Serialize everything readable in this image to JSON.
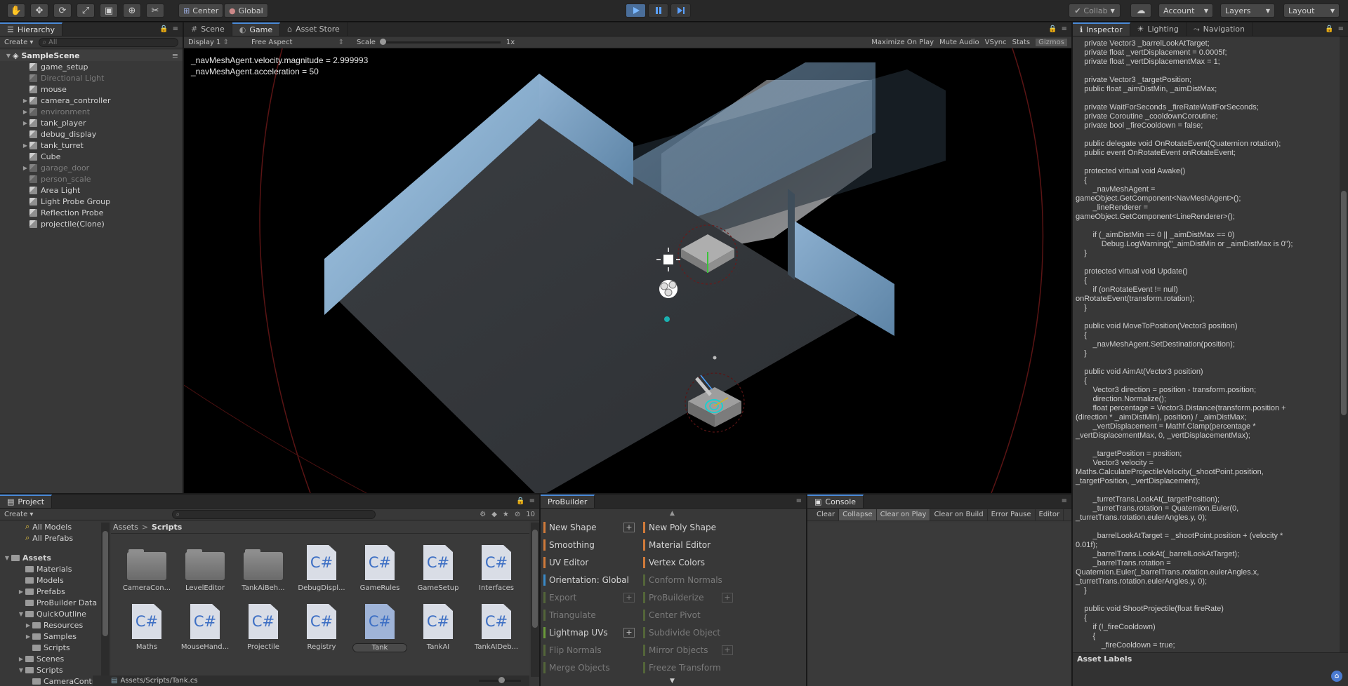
{
  "toolbar": {
    "tools": [
      "hand-tool",
      "move-tool",
      "rotate-tool",
      "scale-tool",
      "rect-tool",
      "transform-tool",
      "custom-tool"
    ],
    "pivot_label": "Center",
    "space_label": "Global",
    "collab_label": "Collab",
    "account_label": "Account",
    "layers_label": "Layers",
    "layout_label": "Layout",
    "play_color": "#4a6e9a"
  },
  "hierarchy": {
    "tab_label": "Hierarchy",
    "create_label": "Create",
    "search_placeholder": "All",
    "scene_name": "SampleScene",
    "items": [
      {
        "label": "game_setup",
        "dim": false,
        "expandable": false
      },
      {
        "label": "Directional Light",
        "dim": true,
        "expandable": false
      },
      {
        "label": "mouse",
        "dim": false,
        "expandable": false
      },
      {
        "label": "camera_controller",
        "dim": false,
        "expandable": true
      },
      {
        "label": "environment",
        "dim": true,
        "expandable": true
      },
      {
        "label": "tank_player",
        "dim": false,
        "expandable": true
      },
      {
        "label": "debug_display",
        "dim": false,
        "expandable": false
      },
      {
        "label": "tank_turret",
        "dim": false,
        "expandable": true
      },
      {
        "label": "Cube",
        "dim": false,
        "expandable": false
      },
      {
        "label": "garage_door",
        "dim": true,
        "expandable": true
      },
      {
        "label": "person_scale",
        "dim": true,
        "expandable": false
      },
      {
        "label": "Area Light",
        "dim": false,
        "expandable": false
      },
      {
        "label": "Light Probe Group",
        "dim": false,
        "expandable": false
      },
      {
        "label": "Reflection Probe",
        "dim": false,
        "expandable": false
      },
      {
        "label": "projectile(Clone)",
        "dim": false,
        "expandable": false
      }
    ]
  },
  "gameview": {
    "tabs": [
      {
        "label": "Scene",
        "active": false
      },
      {
        "label": "Game",
        "active": true
      },
      {
        "label": "Asset Store",
        "active": false
      }
    ],
    "display_label": "Display 1",
    "aspect_label": "Free Aspect",
    "scale_label": "Scale",
    "scale_value": "1x",
    "options": [
      "Maximize On Play",
      "Mute Audio",
      "VSync",
      "Stats",
      "Gizmos"
    ],
    "overlay_lines": [
      "_navMeshAgent.velocity.magnitude = 2.999993",
      "_navMeshAgent.acceleration = 50"
    ]
  },
  "inspector": {
    "tabs": [
      {
        "label": "Inspector",
        "active": true
      },
      {
        "label": "Lighting",
        "active": false
      },
      {
        "label": "Navigation",
        "active": false
      }
    ],
    "code_lines": [
      "    private Vector3 _barrelLookAtTarget;",
      "    private float _vertDisplacement = 0.0005f;",
      "    private float _vertDisplacementMax = 1;",
      "",
      "    private Vector3 _targetPosition;",
      "    public float _aimDistMin, _aimDistMax;",
      "",
      "    private WaitForSeconds _fireRateWaitForSeconds;",
      "    private Coroutine _cooldownCoroutine;",
      "    private bool _fireCooldown = false;",
      "",
      "    public delegate void OnRotateEvent(Quaternion rotation);",
      "    public event OnRotateEvent onRotateEvent;",
      "",
      "    protected virtual void Awake()",
      "    {",
      "        _navMeshAgent =",
      "gameObject.GetComponent<NavMeshAgent>();",
      "        _lineRenderer =",
      "gameObject.GetComponent<LineRenderer>();",
      "",
      "        if (_aimDistMin == 0 || _aimDistMax == 0)",
      "            Debug.LogWarning(\"_aimDistMin or _aimDistMax is 0\");",
      "    }",
      "",
      "    protected virtual void Update()",
      "    {",
      "        if (onRotateEvent != null)",
      "onRotateEvent(transform.rotation);",
      "    }",
      "",
      "    public void MoveToPosition(Vector3 position)",
      "    {",
      "        _navMeshAgent.SetDestination(position);",
      "    }",
      "",
      "    public void AimAt(Vector3 position)",
      "    {",
      "        Vector3 direction = position - transform.position;",
      "        direction.Normalize();",
      "        float percentage = Vector3.Distance(transform.position +",
      "(direction * _aimDistMin), position) / _aimDistMax;",
      "        _vertDisplacement = Mathf.Clamp(percentage *",
      "_vertDisplacementMax, 0, _vertDisplacementMax);",
      "",
      "        _targetPosition = position;",
      "        Vector3 velocity =",
      "Maths.CalculateProjectileVelocity(_shootPoint.position,",
      "_targetPosition, _vertDisplacement);",
      "",
      "        _turretTrans.LookAt(_targetPosition);",
      "        _turretTrans.rotation = Quaternion.Euler(0,",
      "_turretTrans.rotation.eulerAngles.y, 0);",
      "",
      "        _barrelLookAtTarget = _shootPoint.position + (velocity *",
      "0.01f);",
      "        _barrelTrans.LookAt(_barrelLookAtTarget);",
      "        _barrelTrans.rotation =",
      "Quaternion.Euler(_barrelTrans.rotation.eulerAngles.x,",
      "_turretTrans.rotation.eulerAngles.y, 0);",
      "    }",
      "",
      "    public void ShootProjectile(float fireRate)",
      "    {",
      "        if (!_fireCooldown)",
      "        {",
      "            _fireCooldown = true;"
    ],
    "asset_labels": "Asset Labels"
  },
  "project": {
    "tab_label": "Project",
    "create_label": "Create",
    "hidden_count": "10",
    "breadcrumb": [
      "Assets",
      "Scripts"
    ],
    "tree": [
      {
        "label": "All Models",
        "indent": 2,
        "kind": "search",
        "arrow": ""
      },
      {
        "label": "All Prefabs",
        "indent": 2,
        "kind": "search",
        "arrow": ""
      },
      {
        "label": "",
        "indent": 0,
        "kind": "spacer",
        "arrow": ""
      },
      {
        "label": "Assets",
        "indent": 0,
        "kind": "folder-bold",
        "arrow": "▼"
      },
      {
        "label": "Materials",
        "indent": 2,
        "kind": "folder",
        "arrow": ""
      },
      {
        "label": "Models",
        "indent": 2,
        "kind": "folder",
        "arrow": ""
      },
      {
        "label": "Prefabs",
        "indent": 2,
        "kind": "folder",
        "arrow": "▶"
      },
      {
        "label": "ProBuilder Data",
        "indent": 2,
        "kind": "folder",
        "arrow": ""
      },
      {
        "label": "QuickOutline",
        "indent": 2,
        "kind": "folder",
        "arrow": "▼"
      },
      {
        "label": "Resources",
        "indent": 3,
        "kind": "folder",
        "arrow": "▶"
      },
      {
        "label": "Samples",
        "indent": 3,
        "kind": "folder",
        "arrow": "▶"
      },
      {
        "label": "Scripts",
        "indent": 3,
        "kind": "folder",
        "arrow": ""
      },
      {
        "label": "Scenes",
        "indent": 2,
        "kind": "folder",
        "arrow": "▶"
      },
      {
        "label": "Scripts",
        "indent": 2,
        "kind": "folder",
        "arrow": "▼"
      },
      {
        "label": "CameraContr",
        "indent": 3,
        "kind": "folder",
        "arrow": ""
      }
    ],
    "assets": [
      {
        "label": "CameraCon...",
        "kind": "folder"
      },
      {
        "label": "LevelEditor",
        "kind": "folder"
      },
      {
        "label": "TankAiBeh...",
        "kind": "folder"
      },
      {
        "label": "DebugDispl...",
        "kind": "cs"
      },
      {
        "label": "GameRules",
        "kind": "cs"
      },
      {
        "label": "GameSetup",
        "kind": "cs"
      },
      {
        "label": "Interfaces",
        "kind": "cs"
      },
      {
        "label": "Maths",
        "kind": "cs"
      },
      {
        "label": "MouseHand...",
        "kind": "cs"
      },
      {
        "label": "Projectile",
        "kind": "cs"
      },
      {
        "label": "Registry",
        "kind": "cs"
      },
      {
        "label": "Tank",
        "kind": "cs",
        "selected": true
      },
      {
        "label": "TankAI",
        "kind": "cs"
      },
      {
        "label": "TankAIDeb...",
        "kind": "cs"
      }
    ],
    "cs_glyph": "C#",
    "path": "Assets/Scripts/Tank.cs"
  },
  "probuilder": {
    "tab_label": "ProBuilder",
    "left_items": [
      {
        "label": "New Shape",
        "color": "#d07a3a",
        "dim": false,
        "plus": true
      },
      {
        "label": "Smoothing",
        "color": "#d07a3a",
        "dim": false,
        "plus": false
      },
      {
        "label": "UV Editor",
        "color": "#d07a3a",
        "dim": false,
        "plus": false
      },
      {
        "label": "Orientation: Global",
        "color": "#3a8ac8",
        "dim": false,
        "plus": false
      },
      {
        "label": "Export",
        "color": "#6a8a3a",
        "dim": true,
        "plus": true
      },
      {
        "label": "Triangulate",
        "color": "#6a8a3a",
        "dim": true,
        "plus": false
      },
      {
        "label": "Lightmap UVs",
        "color": "#6a9a3a",
        "dim": false,
        "plus": true
      },
      {
        "label": "Flip Normals",
        "color": "#6a8a3a",
        "dim": true,
        "plus": false
      },
      {
        "label": "Merge Objects",
        "color": "#6a8a3a",
        "dim": true,
        "plus": false
      }
    ],
    "right_items": [
      {
        "label": "New Poly Shape",
        "color": "#d07a3a",
        "dim": false,
        "plus": false
      },
      {
        "label": "Material Editor",
        "color": "#d07a3a",
        "dim": false,
        "plus": false
      },
      {
        "label": "Vertex Colors",
        "color": "#d07a3a",
        "dim": false,
        "plus": false
      },
      {
        "label": "Conform Normals",
        "color": "#6a8a3a",
        "dim": true,
        "plus": false
      },
      {
        "label": "ProBuilderize",
        "color": "#6a8a3a",
        "dim": true,
        "plus": true
      },
      {
        "label": "Center Pivot",
        "color": "#6a8a3a",
        "dim": true,
        "plus": false
      },
      {
        "label": "Subdivide Object",
        "color": "#6a8a3a",
        "dim": true,
        "plus": false
      },
      {
        "label": "Mirror Objects",
        "color": "#6a8a3a",
        "dim": true,
        "plus": true
      },
      {
        "label": "Freeze Transform",
        "color": "#6a8a3a",
        "dim": true,
        "plus": false
      }
    ]
  },
  "console": {
    "tab_label": "Console",
    "buttons": [
      {
        "label": "Clear",
        "on": false
      },
      {
        "label": "Collapse",
        "on": true
      },
      {
        "label": "Clear on Play",
        "on": true
      },
      {
        "label": "Clear on Build",
        "on": false
      },
      {
        "label": "Error Pause",
        "on": false
      },
      {
        "label": "Editor",
        "on": false
      }
    ]
  }
}
